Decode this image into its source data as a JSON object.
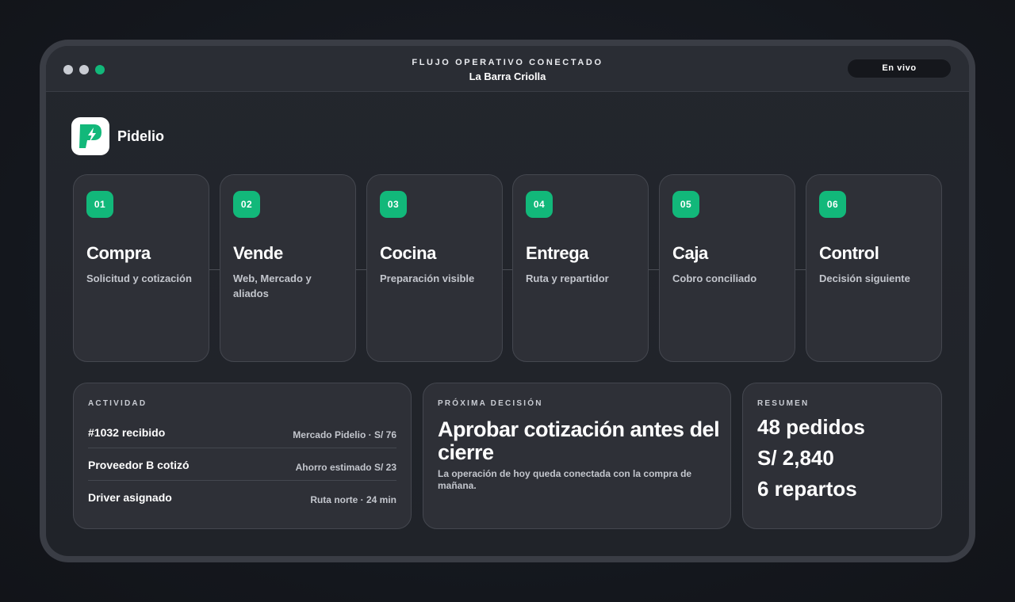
{
  "window": {
    "title": "FLUJO OPERATIVO CONECTADO",
    "subtitle": "La Barra Criolla",
    "status_pill": "En vivo"
  },
  "brand": {
    "name": "Pidelio",
    "logo_icon": "lightning-p-logo-icon"
  },
  "colors": {
    "accent": "#12b87a",
    "card_bg": "#2e3037",
    "window_bg": "#23262d"
  },
  "steps": [
    {
      "number": "01",
      "title": "Compra",
      "description": "Solicitud y cotización"
    },
    {
      "number": "02",
      "title": "Vende",
      "description": "Web, Mercado y aliados"
    },
    {
      "number": "03",
      "title": "Cocina",
      "description": "Preparación visible"
    },
    {
      "number": "04",
      "title": "Entrega",
      "description": "Ruta y repartidor"
    },
    {
      "number": "05",
      "title": "Caja",
      "description": "Cobro conciliado"
    },
    {
      "number": "06",
      "title": "Control",
      "description": "Decisión siguiente"
    }
  ],
  "activity": {
    "label": "ACTIVIDAD",
    "rows": [
      {
        "event": "#1032 recibido",
        "detail": "Mercado Pidelio · S/ 76"
      },
      {
        "event": "Proveedor B cotizó",
        "detail": "Ahorro estimado S/ 23"
      },
      {
        "event": "Driver asignado",
        "detail": "Ruta norte · 24 min"
      }
    ]
  },
  "decision": {
    "label": "PRÓXIMA DECISIÓN",
    "title": "Aprobar cotización antes del cierre",
    "description": "La operación de hoy queda conectada con la compra de mañana."
  },
  "summary": {
    "label": "RESUMEN",
    "orders": "48 pedidos",
    "revenue": "S/ 2,840",
    "deliveries": "6 repartos"
  }
}
